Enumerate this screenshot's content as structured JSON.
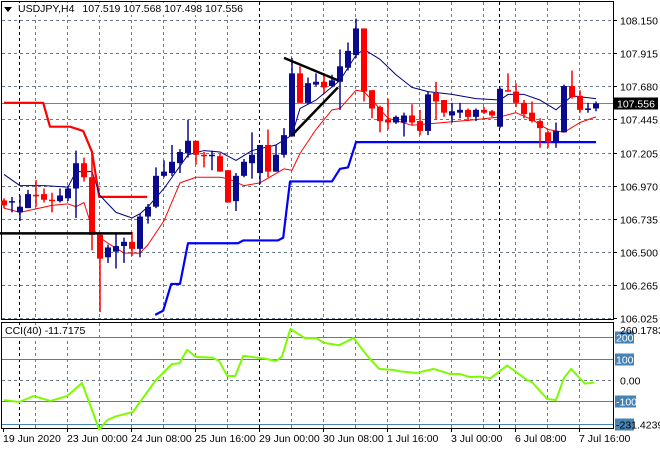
{
  "header": {
    "symbol": "USDJPY,H4",
    "ohlc": "107.519 107.568 107.498 107.556",
    "menu_icon": "triangle-down-icon"
  },
  "colors": {
    "bull": "#0a0a8c",
    "bear": "#ff0000",
    "ma_fast": "#000080",
    "ma_slow": "#ff0000",
    "upper_channel": "#ff0000",
    "lower_channel": "#0000ff",
    "cci": "#7cfc00",
    "cci_levels": "#4682b4",
    "grid": "#6b7b8c"
  },
  "chart_data": [
    {
      "type": "candlestick",
      "title": "USDJPY,H4",
      "x_tick_labels": [
        "19 Jun 2020",
        "23 Jun 00:00",
        "24 Jun 08:00",
        "25 Jun 16:00",
        "29 Jun 00:00",
        "30 Jun 08:00",
        "1 Jul 16:00",
        "3 Jul 00:00",
        "6 Jul 08:00",
        "7 Jul 16:00"
      ],
      "y_tick_labels": [
        "108.150",
        "107.915",
        "107.680",
        "107.445",
        "107.205",
        "106.970",
        "106.735",
        "106.500",
        "106.265",
        "106.025"
      ],
      "ylim": [
        106.025,
        108.15
      ],
      "current_price": "107.556",
      "candles_ohlc": [
        [
          106.865,
          106.88,
          106.81,
          106.83
        ],
        [
          106.85,
          106.89,
          106.78,
          106.86
        ],
        [
          106.78,
          106.9,
          106.72,
          106.82
        ],
        [
          106.81,
          106.94,
          106.81,
          106.91
        ],
        [
          106.905,
          107.01,
          106.82,
          106.9
        ],
        [
          106.91,
          106.95,
          106.85,
          106.87
        ],
        [
          106.87,
          106.92,
          106.78,
          106.86
        ],
        [
          106.86,
          106.95,
          106.85,
          106.9
        ],
        [
          106.88,
          106.97,
          106.86,
          106.95
        ],
        [
          106.95,
          107.22,
          106.74,
          107.13
        ],
        [
          107.13,
          107.17,
          107.0,
          107.03
        ],
        [
          107.03,
          107.22,
          106.51,
          106.62
        ],
        [
          106.62,
          106.63,
          106.07,
          106.45
        ],
        [
          106.46,
          106.55,
          106.42,
          106.53
        ],
        [
          106.5,
          106.63,
          106.38,
          106.54
        ],
        [
          106.54,
          106.6,
          106.42,
          106.57
        ],
        [
          106.57,
          106.64,
          106.47,
          106.52
        ],
        [
          106.52,
          106.77,
          106.46,
          106.75
        ],
        [
          106.75,
          106.84,
          106.7,
          106.82
        ],
        [
          106.82,
          107.1,
          106.81,
          107.04
        ],
        [
          107.04,
          107.15,
          107.03,
          107.07
        ],
        [
          107.06,
          107.26,
          107.04,
          107.14
        ],
        [
          107.13,
          107.23,
          107.06,
          107.21
        ],
        [
          107.2,
          107.44,
          107.17,
          107.29
        ],
        [
          107.29,
          107.29,
          107.12,
          107.19
        ],
        [
          107.19,
          107.21,
          107.1,
          107.185
        ],
        [
          107.18,
          107.22,
          107.08,
          107.19
        ],
        [
          107.18,
          107.2,
          107.07,
          107.07
        ],
        [
          107.08,
          107.08,
          106.85,
          106.85
        ],
        [
          106.86,
          107.06,
          106.79,
          107.04
        ],
        [
          107.04,
          107.16,
          107.03,
          107.14
        ],
        [
          107.13,
          107.35,
          107.02,
          107.19
        ],
        [
          107.06,
          107.26,
          106.98,
          107.26
        ],
        [
          107.26,
          107.37,
          107.03,
          107.07
        ],
        [
          107.07,
          107.26,
          107.07,
          107.19
        ],
        [
          107.19,
          107.38,
          107.17,
          107.33
        ],
        [
          107.32,
          107.88,
          107.32,
          107.77
        ],
        [
          107.77,
          107.82,
          107.56,
          107.56
        ],
        [
          107.56,
          107.74,
          107.55,
          107.7
        ],
        [
          107.69,
          107.77,
          107.68,
          107.71
        ],
        [
          107.71,
          107.76,
          107.63,
          107.67
        ],
        [
          107.68,
          107.76,
          107.67,
          107.72
        ],
        [
          107.71,
          107.94,
          107.51,
          107.82
        ],
        [
          107.81,
          107.99,
          107.79,
          107.93
        ],
        [
          107.9,
          108.16,
          107.88,
          108.09
        ],
        [
          108.09,
          108.09,
          107.57,
          107.64
        ],
        [
          107.65,
          107.65,
          107.45,
          107.52
        ],
        [
          107.53,
          107.54,
          107.35,
          107.43
        ],
        [
          107.44,
          107.59,
          107.37,
          107.42
        ],
        [
          107.42,
          107.47,
          107.41,
          107.46
        ],
        [
          107.42,
          107.49,
          107.32,
          107.47
        ],
        [
          107.47,
          107.55,
          107.4,
          107.42
        ],
        [
          107.43,
          107.51,
          107.33,
          107.36
        ],
        [
          107.36,
          107.64,
          107.33,
          107.62
        ],
        [
          107.63,
          107.71,
          107.44,
          107.57
        ],
        [
          107.58,
          107.58,
          107.46,
          107.49
        ],
        [
          107.47,
          107.56,
          107.42,
          107.5
        ],
        [
          107.49,
          107.56,
          107.45,
          107.51
        ],
        [
          107.51,
          107.52,
          107.43,
          107.46
        ],
        [
          107.46,
          107.52,
          107.43,
          107.51
        ],
        [
          107.51,
          107.53,
          107.48,
          107.49
        ],
        [
          107.5,
          107.51,
          107.46,
          107.47
        ],
        [
          107.39,
          107.67,
          107.38,
          107.66
        ],
        [
          107.65,
          107.77,
          107.64,
          107.64
        ],
        [
          107.64,
          107.7,
          107.53,
          107.56
        ],
        [
          107.56,
          107.58,
          107.45,
          107.48
        ],
        [
          107.49,
          107.57,
          107.42,
          107.43
        ],
        [
          107.43,
          107.45,
          107.24,
          107.38
        ],
        [
          107.35,
          107.36,
          107.24,
          107.28
        ],
        [
          107.28,
          107.42,
          107.24,
          107.36
        ],
        [
          107.35,
          107.69,
          107.35,
          107.68
        ],
        [
          107.68,
          107.79,
          107.59,
          107.6
        ],
        [
          107.61,
          107.65,
          107.49,
          107.51
        ],
        [
          107.51,
          107.56,
          107.49,
          107.52
        ],
        [
          107.52,
          107.57,
          107.5,
          107.556
        ]
      ],
      "ma_fast": [
        [
          0,
          107.05
        ],
        [
          2,
          106.97
        ],
        [
          5,
          106.97
        ],
        [
          8,
          106.96
        ],
        [
          9,
          107.07
        ],
        [
          11,
          107.07
        ],
        [
          12,
          106.9
        ],
        [
          14,
          106.78
        ],
        [
          16,
          106.74
        ],
        [
          17,
          106.77
        ],
        [
          18,
          106.82
        ],
        [
          20,
          106.95
        ],
        [
          23,
          107.19
        ],
        [
          25,
          107.22
        ],
        [
          27,
          107.21
        ],
        [
          29,
          107.15
        ],
        [
          31,
          107.22
        ],
        [
          34,
          107.26
        ],
        [
          36,
          107.33
        ],
        [
          37,
          107.52
        ],
        [
          39,
          107.58
        ],
        [
          42,
          107.72
        ],
        [
          44,
          107.9
        ],
        [
          45,
          107.94
        ],
        [
          47,
          107.87
        ],
        [
          49,
          107.76
        ],
        [
          51,
          107.67
        ],
        [
          53,
          107.64
        ],
        [
          56,
          107.62
        ],
        [
          59,
          107.59
        ],
        [
          62,
          107.58
        ],
        [
          63,
          107.62
        ],
        [
          65,
          107.62
        ],
        [
          67,
          107.58
        ],
        [
          69,
          107.51
        ],
        [
          71,
          107.61
        ],
        [
          74,
          107.59
        ]
      ],
      "ma_slow": [
        [
          0,
          106.81
        ],
        [
          2,
          106.78
        ],
        [
          6,
          106.83
        ],
        [
          8,
          106.84
        ],
        [
          9,
          106.82
        ],
        [
          10,
          106.85
        ],
        [
          11,
          106.67
        ],
        [
          12,
          106.6
        ],
        [
          13,
          106.56
        ],
        [
          15,
          106.49
        ],
        [
          17,
          106.49
        ],
        [
          18,
          106.55
        ],
        [
          20,
          106.72
        ],
        [
          22,
          106.99
        ],
        [
          24,
          107.03
        ],
        [
          27,
          107.03
        ],
        [
          28,
          107.02
        ],
        [
          30,
          106.97
        ],
        [
          32,
          106.99
        ],
        [
          35,
          107.09
        ],
        [
          36,
          107.08
        ],
        [
          37,
          107.2
        ],
        [
          39,
          107.37
        ],
        [
          41,
          107.51
        ],
        [
          42,
          107.52
        ],
        [
          44,
          107.65
        ],
        [
          45,
          107.64
        ],
        [
          46,
          107.58
        ],
        [
          48,
          107.45
        ],
        [
          51,
          107.4
        ],
        [
          55,
          107.42
        ],
        [
          59,
          107.44
        ],
        [
          62,
          107.46
        ],
        [
          64,
          107.49
        ],
        [
          66,
          107.44
        ],
        [
          68,
          107.37
        ],
        [
          70,
          107.35
        ],
        [
          72,
          107.42
        ],
        [
          74,
          107.46
        ]
      ],
      "upper_channel": [
        [
          0,
          107.56
        ],
        [
          4.9,
          107.56
        ],
        [
          5.75,
          107.39
        ],
        [
          8.25,
          107.39
        ],
        [
          9.9,
          107.36
        ],
        [
          11,
          107.21
        ],
        [
          11.9,
          106.89
        ],
        [
          17.9,
          106.89
        ]
      ],
      "lower_channel": [
        [
          18.9,
          106.05
        ],
        [
          19.9,
          106.08
        ],
        [
          20.9,
          106.27
        ],
        [
          22,
          106.27
        ],
        [
          23,
          106.56
        ],
        [
          29.25,
          106.56
        ],
        [
          29.9,
          106.58
        ],
        [
          34.25,
          106.58
        ],
        [
          34.9,
          106.6
        ],
        [
          35.75,
          107.0
        ],
        [
          41,
          107.0
        ],
        [
          42,
          107.09
        ],
        [
          43,
          107.1
        ],
        [
          44,
          107.28
        ],
        [
          74,
          107.28
        ]
      ],
      "trendlines": [
        [
          [
            -0.5,
            106.63
          ],
          [
            16,
            106.63
          ]
        ],
        [
          [
            35,
            107.88
          ],
          [
            41.75,
            107.72
          ]
        ],
        [
          [
            36,
            107.33
          ],
          [
            41.75,
            107.67
          ]
        ]
      ]
    },
    {
      "type": "line",
      "title": "CCI(40)",
      "current_value": "-11.7175",
      "ylim": [
        -231.4239,
        260.1783
      ],
      "top_label": "260.1783",
      "bottom_label": "-231.4239",
      "zero_label": "0.00",
      "levels": [
        200,
        100,
        -100
      ],
      "level_labels": [
        "200",
        "100",
        "-100"
      ],
      "x": [
        0,
        1.9,
        3.7,
        5.8,
        7.9,
        9.75,
        11.9,
        12.9,
        14,
        16.1,
        19,
        21,
        21.9,
        22.9,
        24,
        26,
        26.9,
        27.9,
        28.9,
        29.9,
        31,
        32.6,
        34,
        34.75,
        35.8,
        37.6,
        39,
        40,
        41.9,
        43.7,
        45.3,
        46.9,
        48.7,
        49.7,
        51.6,
        53.7,
        55.8,
        57,
        58.2,
        59.5,
        60.8,
        62.9,
        65.3,
        66,
        67.9,
        69,
        70,
        70.9,
        72.6,
        73.8
      ],
      "values": [
        -94,
        -103,
        -75,
        -98,
        -75,
        -14,
        -232,
        -188,
        -170,
        -150,
        0,
        75,
        78,
        141,
        108,
        105,
        89,
        19,
        19,
        113,
        108,
        100,
        89,
        110,
        239,
        197,
        197,
        174,
        163,
        197,
        118,
        52,
        47,
        40,
        33,
        52,
        28,
        28,
        14,
        16,
        8,
        68,
        2,
        -10,
        -89,
        -94,
        10,
        52,
        -17,
        -12
      ]
    }
  ]
}
